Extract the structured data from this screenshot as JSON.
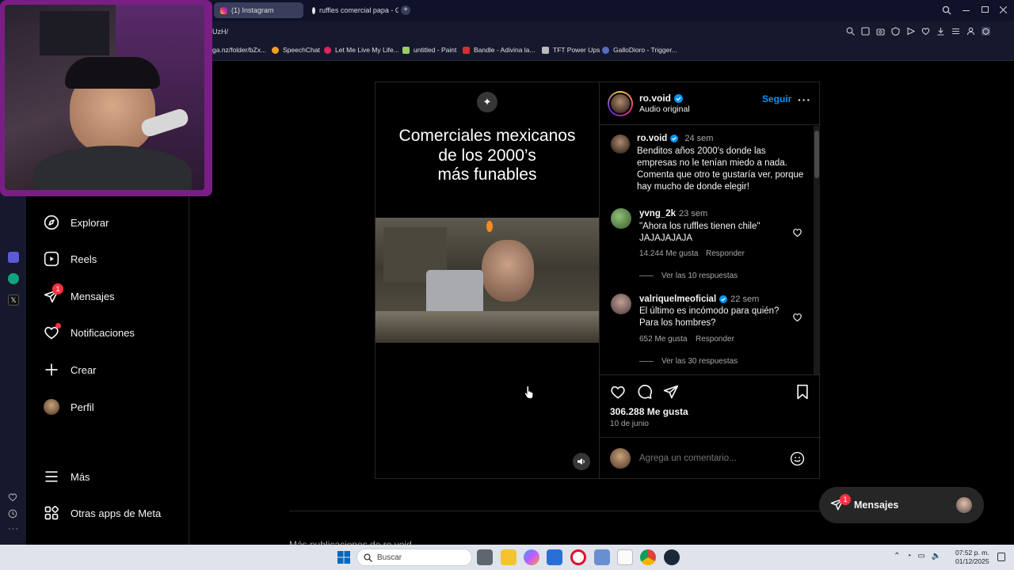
{
  "browser": {
    "tabs": [
      {
        "label": "(1) Instagram"
      },
      {
        "label": "ruffles comercial papa - G"
      }
    ],
    "address": "UzH/",
    "bookmarks": [
      "ga.nz/folder/bZx...",
      "SpeechChat",
      "Let Me Live My Life...",
      "untitled - Paint",
      "Bandle - Adivina la...",
      "TFT Power Ups",
      "GalloDioro - Trigger..."
    ]
  },
  "sidebar": {
    "items": [
      {
        "label": "Explorar",
        "icon": "compass-icon"
      },
      {
        "label": "Reels",
        "icon": "reels-icon"
      },
      {
        "label": "Mensajes",
        "icon": "messenger-icon",
        "badge": "1"
      },
      {
        "label": "Notificaciones",
        "icon": "heart-icon"
      },
      {
        "label": "Crear",
        "icon": "plus-icon"
      },
      {
        "label": "Perfil",
        "icon": "avatar"
      }
    ],
    "more": "Más",
    "meta_apps": "Otras apps de Meta"
  },
  "post": {
    "overlay_title": "Comerciales mexicanos\nde los 2000’s\nmás funables",
    "author": "ro.void",
    "audio": "Audio original",
    "follow": "Seguir",
    "caption": {
      "user": "ro.void",
      "time": "24 sem",
      "text": "Benditos años 2000's donde las empresas no le tenían miedo a nada. Comenta que otro te gustaría ver, porque hay mucho de donde elegir!"
    },
    "comments": [
      {
        "user": "yvng_2k",
        "time": "23 sem",
        "text": "\"Ahora los ruffles tienen chile\" JAJAJAJAJA",
        "likes": "14.244 Me gusta",
        "reply": "Responder",
        "replies": "Ver las 10 respuestas",
        "verified": false
      },
      {
        "user": "valriquelmeoficial",
        "time": "22 sem",
        "text": "El último es incómodo para quién? Para los hombres?",
        "likes": "652 Me gusta",
        "reply": "Responder",
        "replies": "Ver las 30 respuestas",
        "verified": true
      }
    ],
    "likes": "306.288 Me gusta",
    "date": "10 de junio",
    "comment_placeholder": "Agrega un comentario..."
  },
  "more_posts": "Más publicaciones de ro.void",
  "messages_pill": {
    "label": "Mensajes",
    "badge": "1"
  },
  "taskbar": {
    "search": "Buscar",
    "time": "07:52 p. m.",
    "date": "01/12/2025"
  },
  "colors": {
    "accent": "#0095f6",
    "badge": "#ff3040",
    "cam_border": "#7a1e86"
  }
}
